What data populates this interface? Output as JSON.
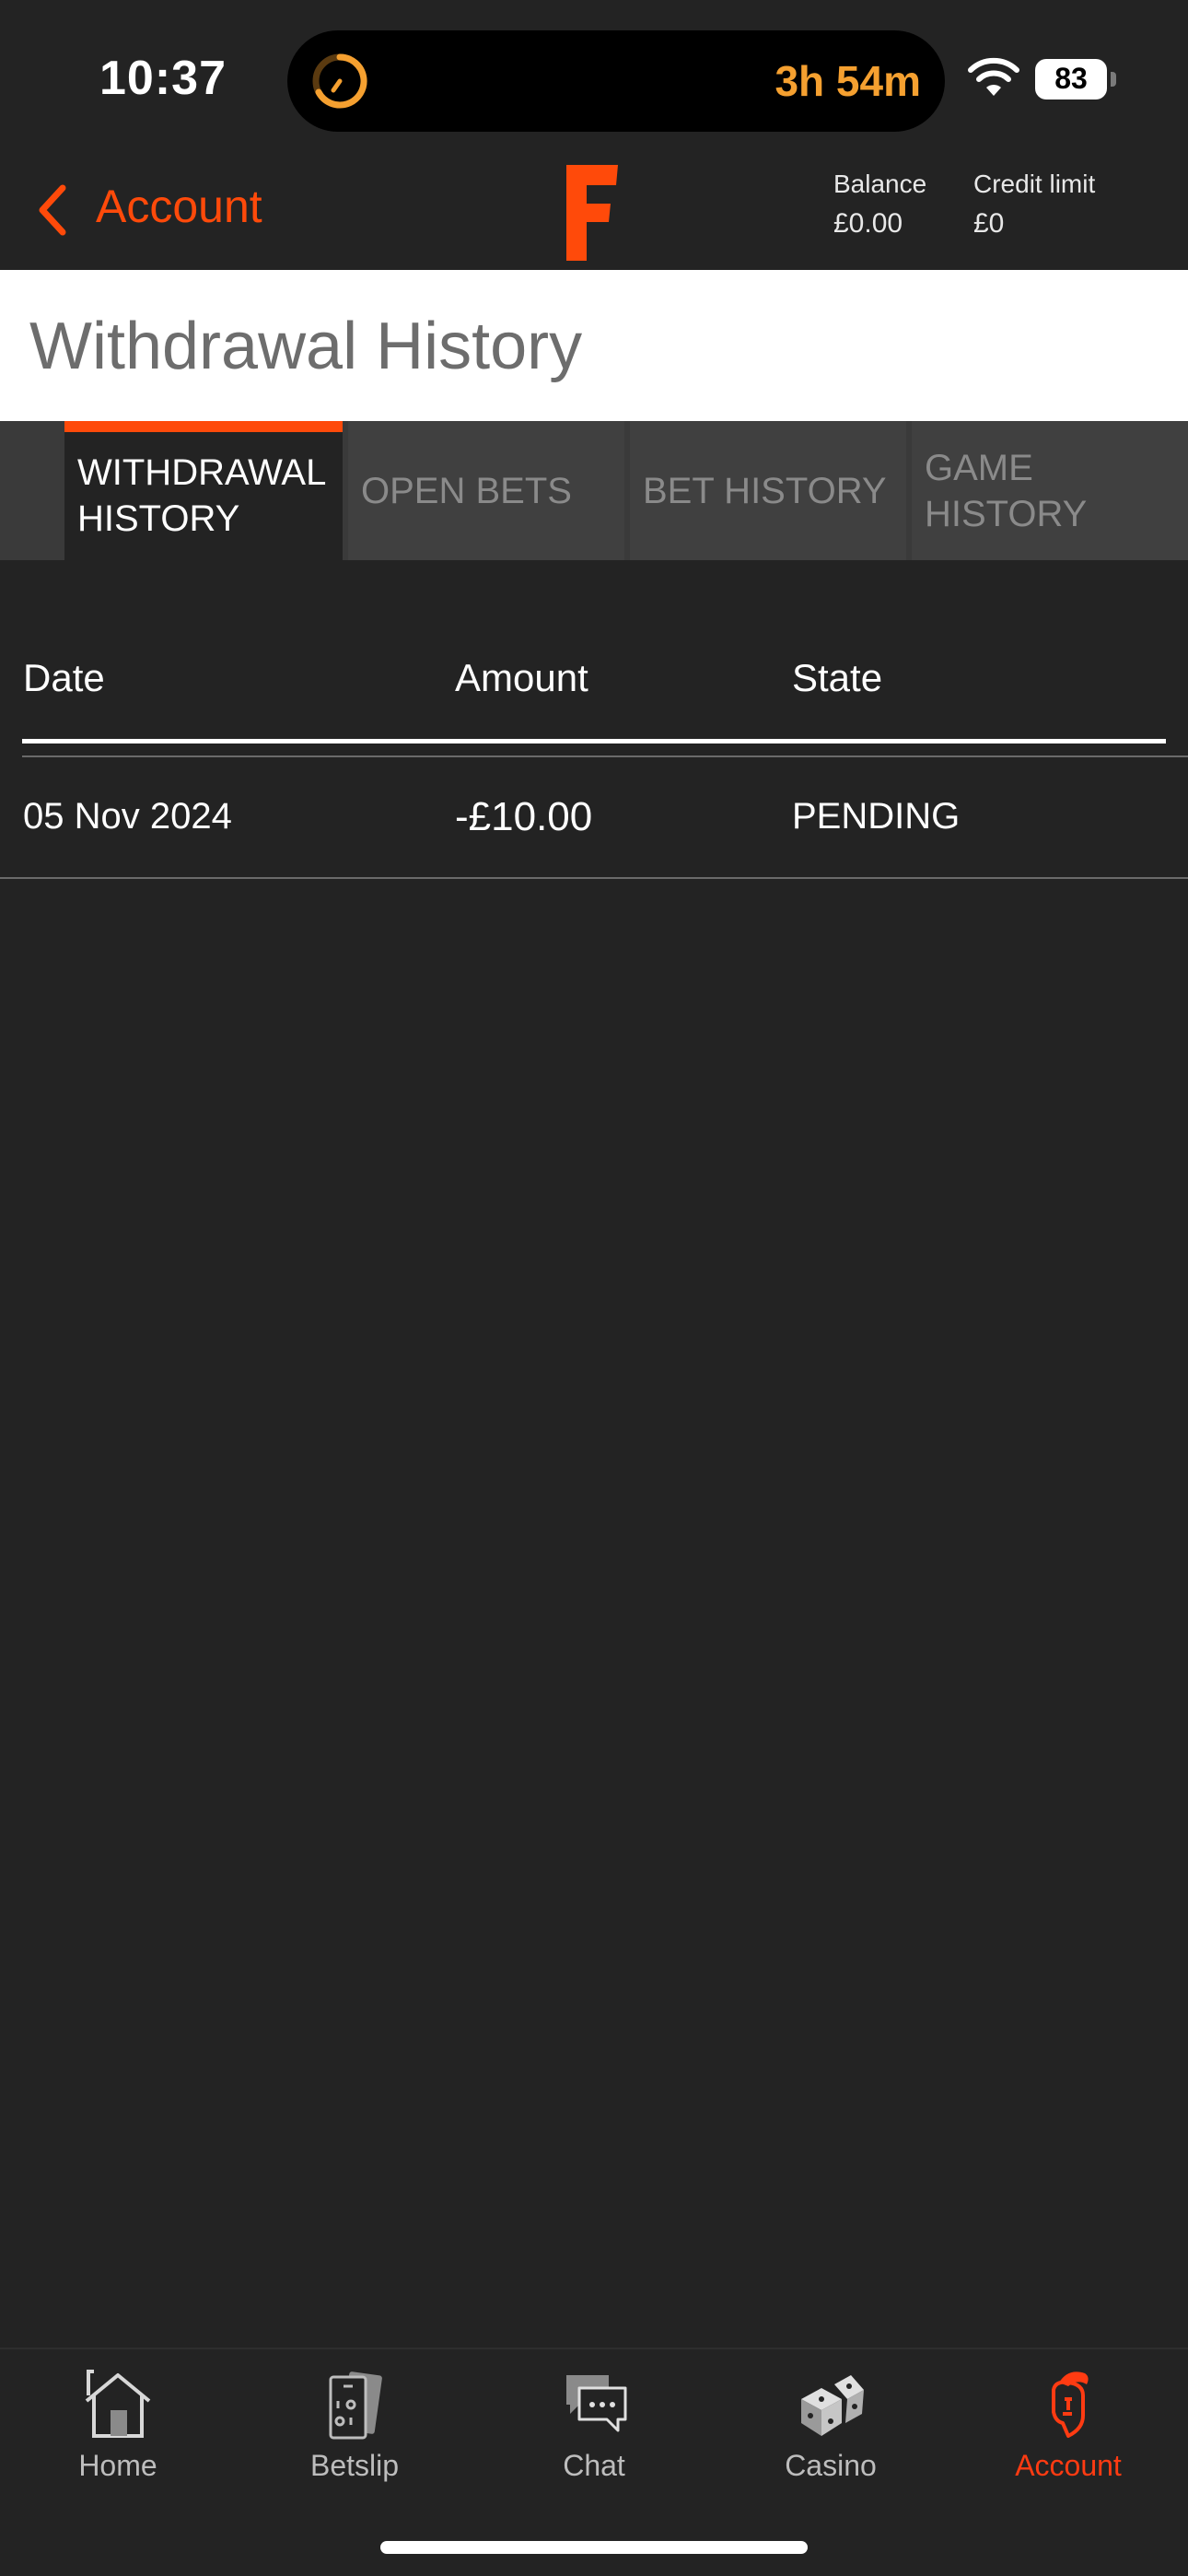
{
  "status_bar": {
    "time": "10:37",
    "timer": "3h 54m",
    "battery": "83"
  },
  "header": {
    "back_label": "Account",
    "balance_label": "Balance",
    "balance_value": "£0.00",
    "credit_label": "Credit limit",
    "credit_value": "£0"
  },
  "page_title": "Withdrawal History",
  "tabs": [
    {
      "label": "WITHDRAWAL HISTORY",
      "active": true
    },
    {
      "label": "OPEN BETS",
      "active": false
    },
    {
      "label": "BET HISTORY",
      "active": false
    },
    {
      "label": "GAME HISTORY",
      "active": false
    }
  ],
  "table": {
    "columns": [
      "Date",
      "Amount",
      "State"
    ],
    "rows": [
      {
        "date": "05 Nov 2024",
        "amount": "-£10.00",
        "state": "PENDING"
      }
    ]
  },
  "bottom_nav": [
    {
      "label": "Home",
      "icon": "home-icon",
      "active": false
    },
    {
      "label": "Betslip",
      "icon": "betslip-icon",
      "active": false
    },
    {
      "label": "Chat",
      "icon": "chat-icon",
      "active": false
    },
    {
      "label": "Casino",
      "icon": "dice-icon",
      "active": false
    },
    {
      "label": "Account",
      "icon": "account-icon",
      "active": true
    }
  ],
  "colors": {
    "accent": "#ff4a0a",
    "background": "#232323",
    "timer": "#f5a030"
  }
}
